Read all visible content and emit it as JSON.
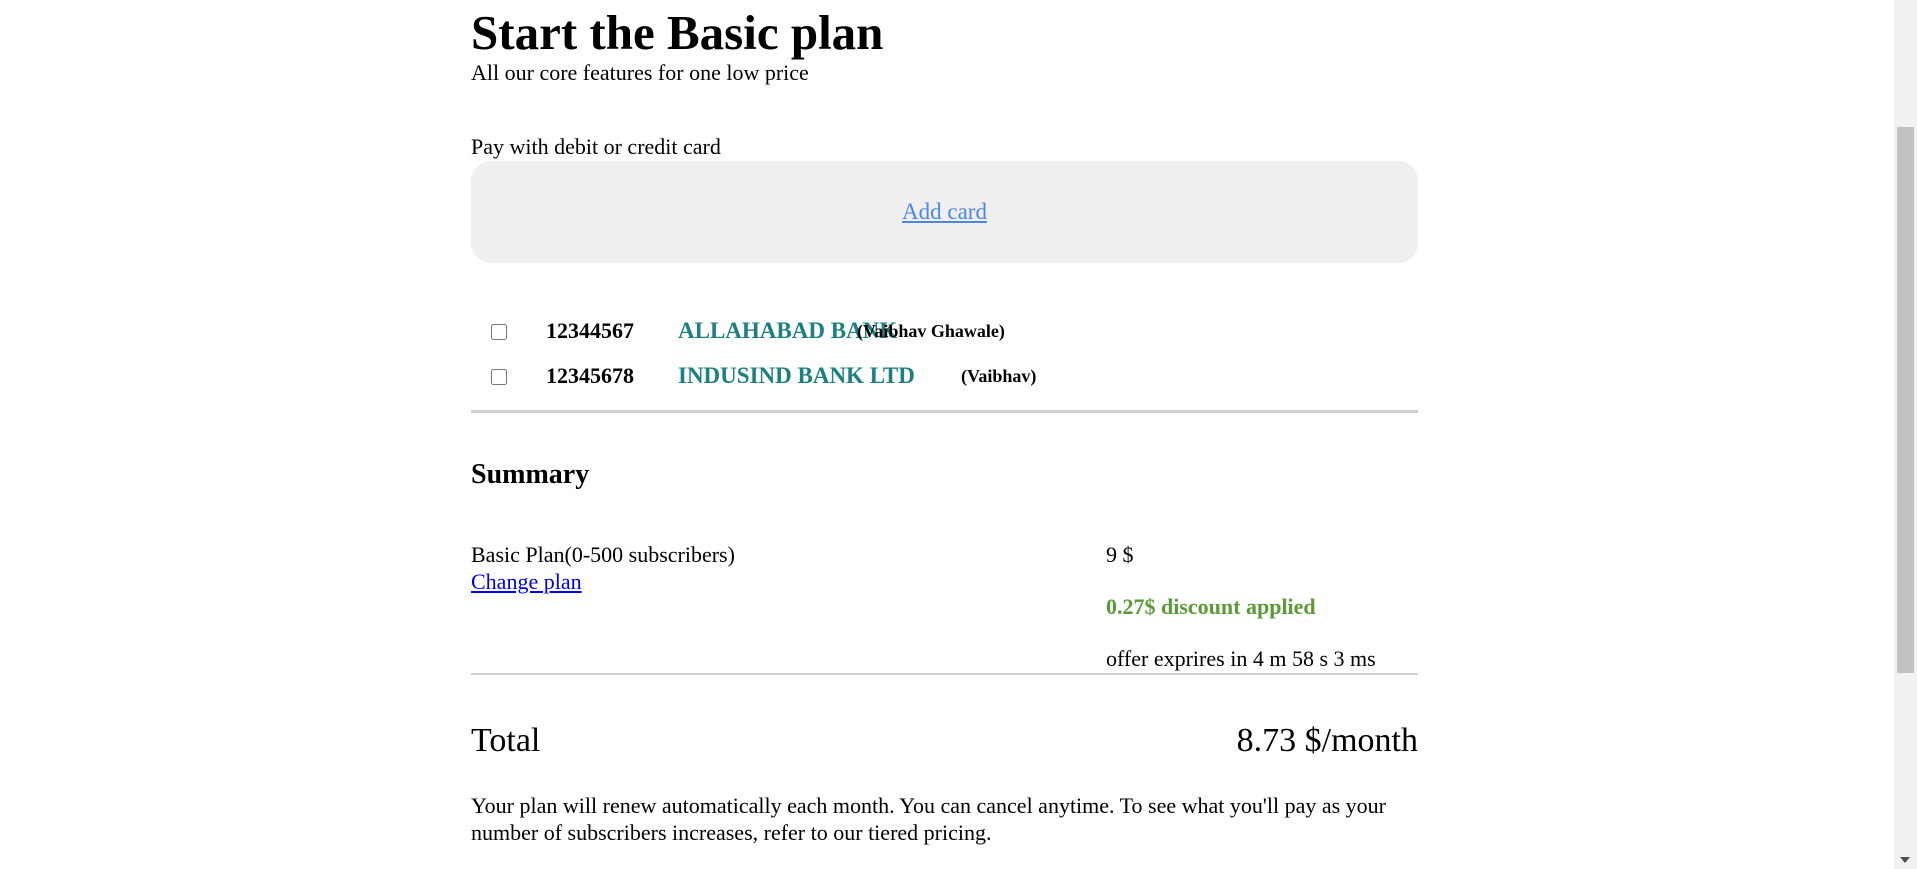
{
  "header": {
    "title": "Start the Basic plan",
    "subtitle": "All our core features for one low price"
  },
  "payment": {
    "label": "Pay with debit or credit card",
    "add_card_label": "Add card"
  },
  "banks": [
    {
      "account": "12344567",
      "name": "ALLAHABAD BANK",
      "holder": "(Vaibhav Ghawale)",
      "checked": false
    },
    {
      "account": "12345678",
      "name": "INDUSIND BANK LTD",
      "holder": "(Vaibhav)",
      "checked": false
    }
  ],
  "summary": {
    "title": "Summary",
    "plan_name": "Basic Plan(0-500 subscribers)",
    "change_plan_label": "Change plan",
    "price": "9 $",
    "discount": "0.27$ discount applied",
    "offer_prefix": "offer exprires in",
    "offer_minutes": "4 m",
    "offer_seconds": "58 s",
    "offer_ms": "3 ms"
  },
  "total": {
    "label": "Total",
    "value": "8.73 $/month"
  },
  "renew_note": "Your plan will renew automatically each month. You can cancel anytime. To see what you'll pay as your number of subscribers increases, refer to our tiered pricing.",
  "colors": {
    "bank_name": "#1a8080",
    "discount": "#5a9b35",
    "add_card_link": "#4a86e8",
    "card_box_bg": "#f0efee"
  }
}
